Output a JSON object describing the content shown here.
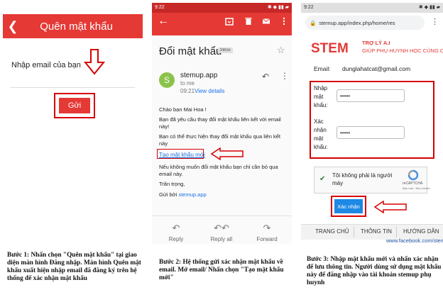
{
  "panel1": {
    "title": "Quên mật khẩu",
    "back_icon": "arrow-left-icon",
    "email_label": "Nhập email của bạn",
    "send_button": "Gửi",
    "accent_color": "#e53935",
    "highlight_color": "#d50000"
  },
  "panel2": {
    "status_time": "9:22",
    "subject": "Đổi mật khẩu",
    "label_badge": "Inbox",
    "sender": "stemup.app",
    "to": "to me",
    "time": "09:21",
    "view_details": "View details",
    "body": {
      "greeting": "Chào bạn Mai Hoa !",
      "line1": "Bạn đã yêu cầu thay đổi mật khẩu liên kết với email này!",
      "line2": "Bạn có thể thực hiện thay đổi mật khẩu qua liên kết này",
      "link": "Tạo mật khẩu mới",
      "line3": "Nếu không muốn đổi mật khẩu bạn chỉ cần bỏ qua email này.",
      "regards": "Trân trọng,",
      "sent_by": "Gửi bởi",
      "sent_by_link": "stemup.app"
    },
    "actions": [
      {
        "label": "Reply",
        "icon": "reply-icon"
      },
      {
        "label": "Reply all",
        "icon": "reply-all-icon"
      },
      {
        "label": "Forward",
        "icon": "forward-icon"
      }
    ]
  },
  "panel3": {
    "status_time": "9:22",
    "url": "stemup.app/index.php/home/res",
    "logo_text": "STEM",
    "tagline1": "TRỢ LÝ A.I",
    "tagline2": "GIÚP PHỤ HUYNH HỌC CÙNG CON",
    "email_label": "Email:",
    "email_value": "dunglahatcat@gmail.com",
    "password_label": "Nhập mật khẩu:",
    "confirm_label": "Xác nhận mật khẩu:",
    "password_value": "•••••",
    "confirm_value": "•••••",
    "captcha_text": "Tôi không phải là người máy",
    "captcha_brand": "reCAPTCHA",
    "captcha_links": "Bảo mật - Điều khoản",
    "confirm_button": "Xác nhận",
    "nav": [
      "TRANG CHỦ",
      "THÔNG TIN",
      "HƯỚNG DẪN"
    ],
    "footer_link": "www.facebook.com/stemup"
  },
  "captions": {
    "step1": "Bước 1: Nhấn chọn \"Quên mật khẩu\" tại giao diện màn hình Đăng nhập. Màn hình Quên mật khẩu xuất hiện nhập email đã đăng ký trên hệ thống để xác nhận mật khẩu",
    "step2": "Bước 2: Hệ thống gửi xác nhận mật khẩu về email. Mở email/ Nhấn chọn \"Tạo mật khẩu mới\"",
    "step3": "Bước 3: Nhập mật khẩu mới và nhấn xác nhận để lưu thông tin. Người dùng sử dụng mật khẩu này để đăng nhập vào tài khoản stemup phụ huynh"
  }
}
